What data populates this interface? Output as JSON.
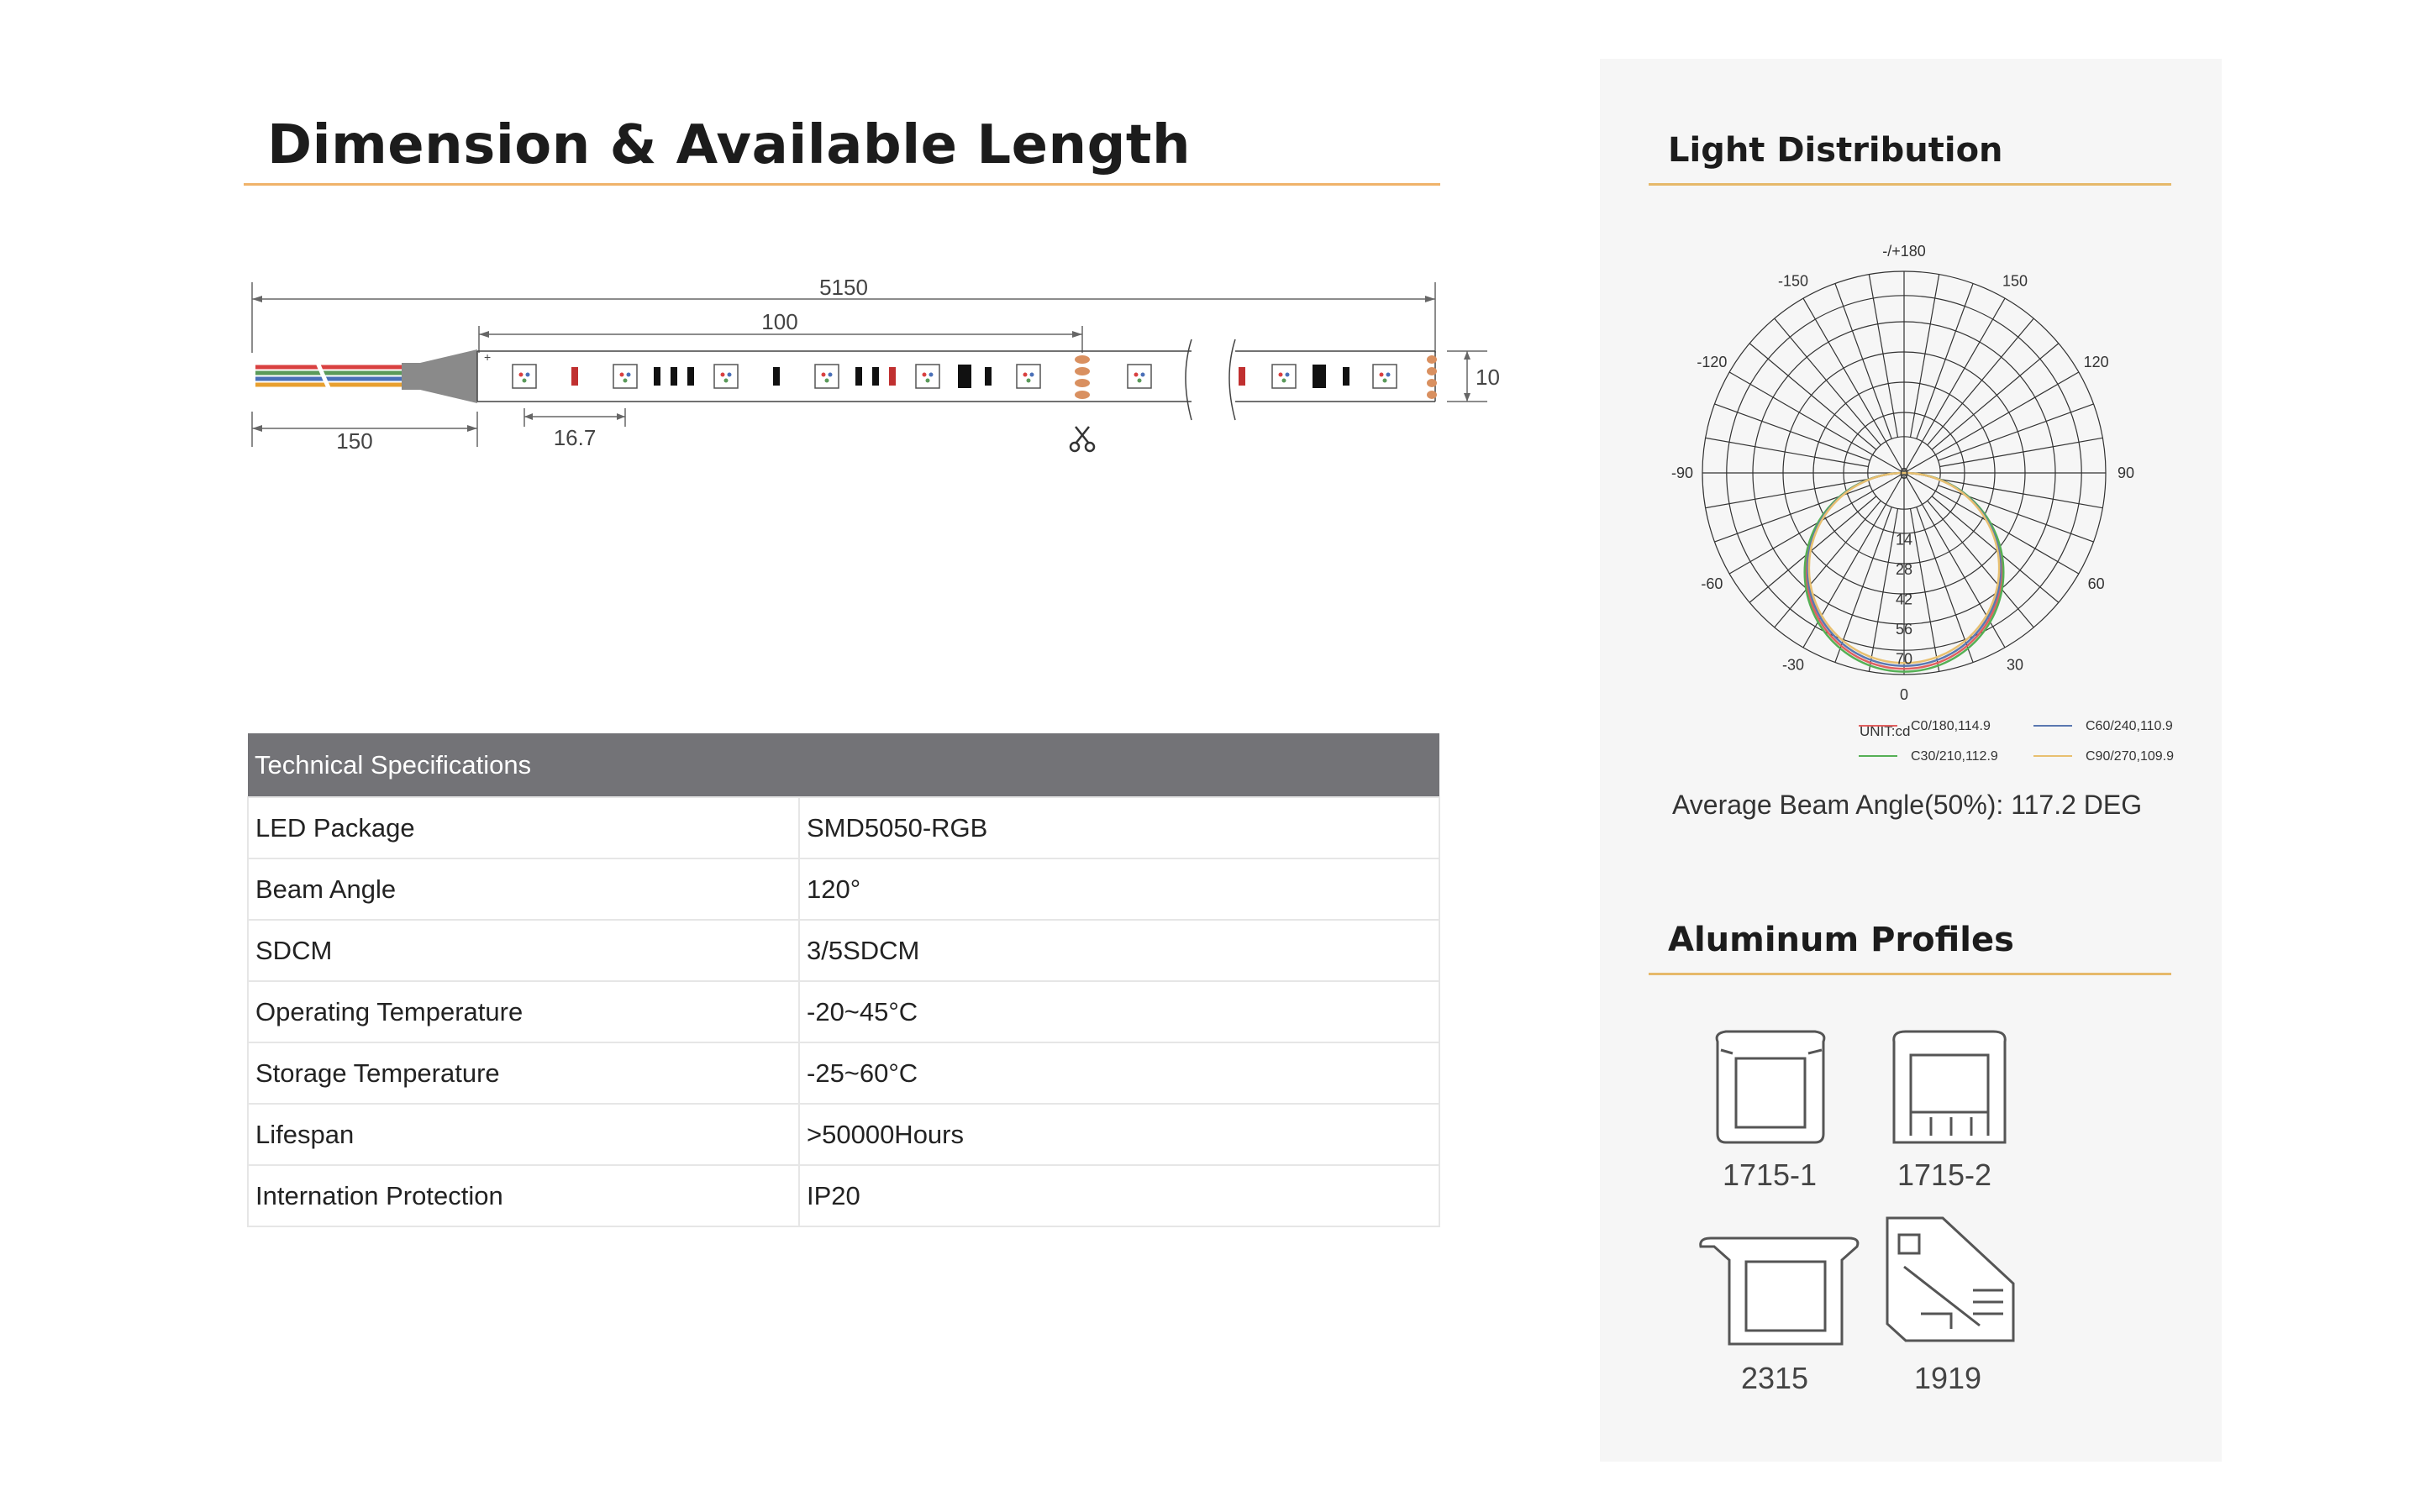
{
  "title": "Dimension & Available Length",
  "dimensions": {
    "total_length": "5150",
    "cut_unit": "100",
    "lead_length": "150",
    "led_pitch": "16.7",
    "width": "10"
  },
  "specs": {
    "header": "Technical Specifications",
    "rows": [
      {
        "label": "LED Package",
        "value": "SMD5050-RGB"
      },
      {
        "label": "Beam Angle",
        "value": "120°"
      },
      {
        "label": "SDCM",
        "value": "3/5SDCM"
      },
      {
        "label": "Operating Temperature",
        "value": "-20~45°C"
      },
      {
        "label": "Storage Temperature",
        "value": "-25~60°C"
      },
      {
        "label": "Lifespan",
        "value": ">50000Hours"
      },
      {
        "label": "Internation Protection",
        "value": "IP20"
      }
    ]
  },
  "light_distribution": {
    "title": "Light Distribution",
    "angle_labels": [
      "-/+180",
      "150",
      "120",
      "90",
      "60",
      "30",
      "0",
      "-30",
      "-60",
      "-90",
      "-120",
      "-150"
    ],
    "radial_labels": [
      "0",
      "14",
      "28",
      "42",
      "56",
      "70"
    ],
    "unit": "UNIT:cd",
    "legend": [
      {
        "label": "C0/180,114.9",
        "color": "#e06060"
      },
      {
        "label": "C60/240,110.9",
        "color": "#5a78b0"
      },
      {
        "label": "C30/210,112.9",
        "color": "#55b055"
      },
      {
        "label": "C90/270,109.9",
        "color": "#e8c070"
      }
    ],
    "beam_angle_text": "Average Beam Angle(50%): 117.2 DEG"
  },
  "chart_data": {
    "type": "polar",
    "radial_ticks": [
      0,
      14,
      28,
      42,
      56,
      70
    ],
    "rmax": 70,
    "series": [
      {
        "name": "C0/180,114.9",
        "color": "#e06060",
        "peak": 68
      },
      {
        "name": "C30/210,112.9",
        "color": "#55b055",
        "peak": 69
      },
      {
        "name": "C60/240,110.9",
        "color": "#5a78b0",
        "peak": 67
      },
      {
        "name": "C90/270,109.9",
        "color": "#e8c070",
        "peak": 66
      }
    ]
  },
  "profiles": {
    "title": "Aluminum Profiles",
    "items": [
      "1715-1",
      "1715-2",
      "2315",
      "1919"
    ]
  }
}
